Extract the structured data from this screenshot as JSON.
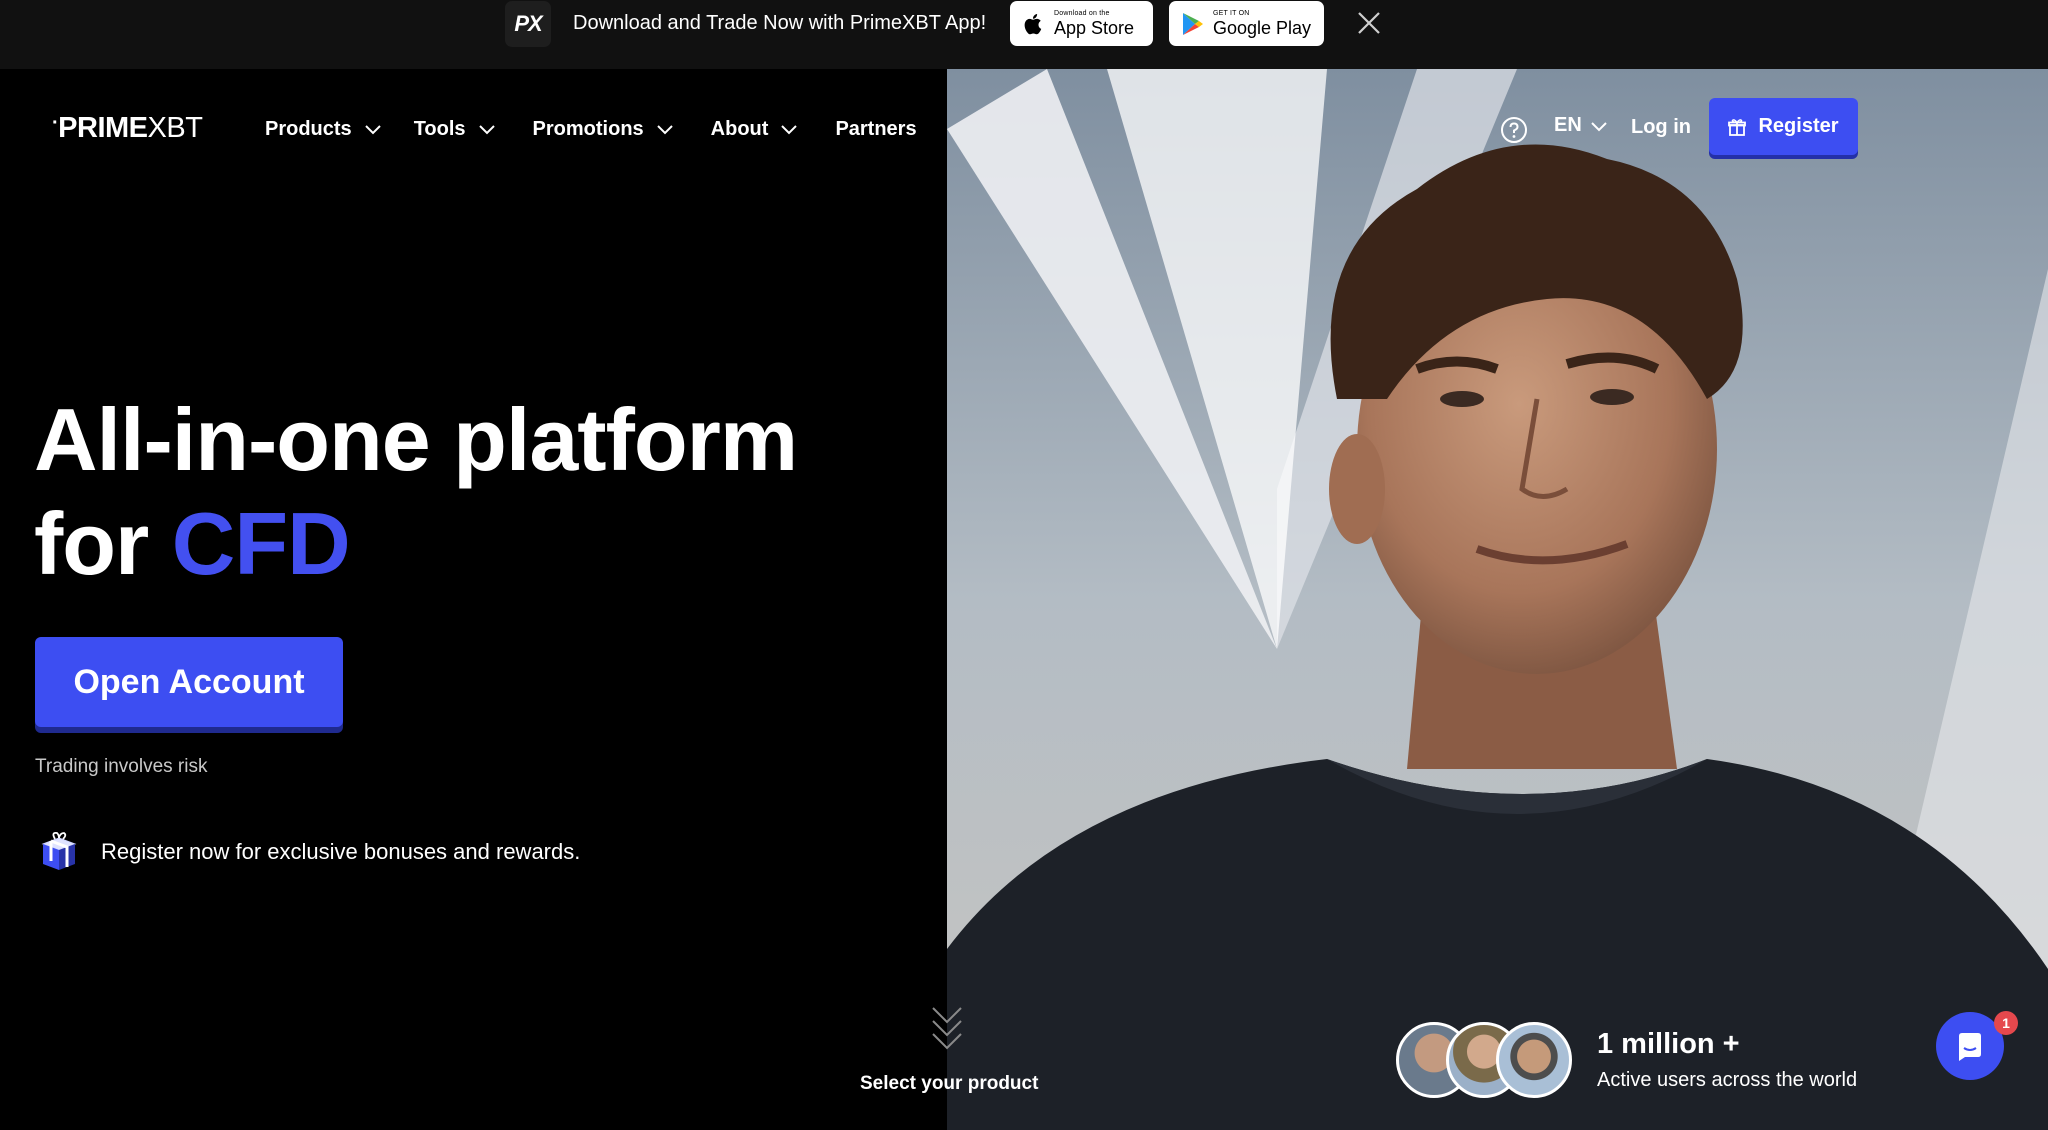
{
  "banner": {
    "logo_text": "PX",
    "text": "Download and Trade Now with PrimeXBT App!",
    "app_store": {
      "small": "Download on the",
      "big": "App Store"
    },
    "google_play": {
      "small": "GET IT ON",
      "big": "Google Play"
    },
    "close_icon": "close-icon"
  },
  "header": {
    "logo": {
      "prime": "PRIME",
      "xbt": "XBT"
    },
    "nav": [
      {
        "label": "Products",
        "has_dropdown": true
      },
      {
        "label": "Tools",
        "has_dropdown": true
      },
      {
        "label": "Promotions",
        "has_dropdown": true
      },
      {
        "label": "About",
        "has_dropdown": true
      },
      {
        "label": "Partners",
        "has_dropdown": false
      }
    ],
    "help_icon": "question-circle-icon",
    "language": "EN",
    "login": "Log in",
    "register": "Register"
  },
  "hero": {
    "title_line1": "All-in-one platform",
    "title_line2_prefix": "for",
    "title_line2_accent": "CFD",
    "cta": "Open Account",
    "risk_note": "Trading involves risk",
    "promo_text": "Register now for exclusive bonuses and rewards."
  },
  "scroll_hint": {
    "label": "Select your product"
  },
  "stats": {
    "value": "1 million +",
    "label": "Active users across the world"
  },
  "chat": {
    "badge": "1"
  },
  "colors": {
    "accent": "#3d4ef2",
    "accent_text": "#4350f0",
    "background": "#000000",
    "banner": "#111111"
  }
}
